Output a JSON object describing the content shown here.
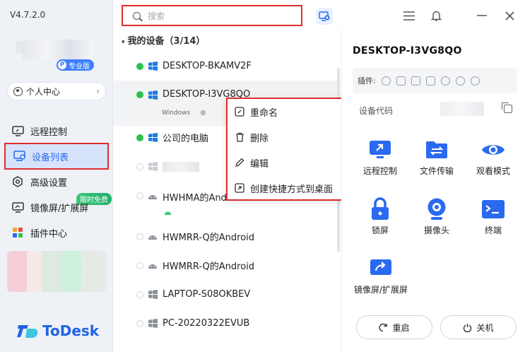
{
  "app": {
    "version": "V4.7.2.0",
    "pro_badge_letter": "P",
    "pro_badge": "专业版",
    "personal_center": "个人中心",
    "logo_text": "ToDesk"
  },
  "sidebar": {
    "items": [
      {
        "label": "远程控制",
        "icon": "monitor-icon"
      },
      {
        "label": "设备列表",
        "icon": "device-list-icon",
        "active": true
      },
      {
        "label": "高级设置",
        "icon": "gear-icon"
      },
      {
        "label": "镜像屏/扩展屏",
        "icon": "mirror-screen-icon"
      },
      {
        "label": "插件中心",
        "icon": "plugin-icon"
      }
    ],
    "free_tag": "限时免费"
  },
  "search": {
    "placeholder": "搜索"
  },
  "list": {
    "group_title": "我的设备（3/14）",
    "devices": [
      {
        "name": "DESKTOP-BKAMV2F",
        "online": true,
        "os": "windows"
      },
      {
        "name": "DESKTOP-I3VG8QO",
        "online": true,
        "os": "windows",
        "selected": true,
        "sub": "Windows"
      },
      {
        "name": "公司的电脑",
        "online": true,
        "os": "windows"
      },
      {
        "name": "",
        "online": false,
        "os": "windows"
      },
      {
        "name": "HWHMA的Android",
        "online": false,
        "os": "android"
      },
      {
        "name": "HWMRR-Q的Android",
        "online": false,
        "os": "android"
      },
      {
        "name": "HWMRR-Q的Android",
        "online": false,
        "os": "android"
      },
      {
        "name": "LAPTOP-S08OKBEV",
        "online": false,
        "os": "windows"
      },
      {
        "name": "PC-20220322EVUB",
        "online": false,
        "os": "windows"
      }
    ]
  },
  "context_menu": {
    "items": [
      {
        "label": "重命名",
        "icon": "rename-icon"
      },
      {
        "label": "删除",
        "icon": "trash-icon"
      },
      {
        "label": "编辑",
        "icon": "pencil-icon"
      },
      {
        "label": "创建快捷方式到桌面",
        "icon": "shortcut-icon"
      }
    ]
  },
  "detail": {
    "title": "DESKTOP-I3VG8QO",
    "plugins_label": "插件:",
    "device_code_label": "设备代码",
    "features": [
      {
        "label": "远程控制",
        "icon": "remote-control-icon"
      },
      {
        "label": "文件传输",
        "icon": "file-transfer-icon"
      },
      {
        "label": "观看模式",
        "icon": "eye-icon"
      },
      {
        "label": "锁屏",
        "icon": "lock-icon"
      },
      {
        "label": "摄像头",
        "icon": "camera-icon"
      },
      {
        "label": "终端",
        "icon": "terminal-icon"
      },
      {
        "label": "镜像屏/扩展屏",
        "icon": "mirror-screen-icon"
      }
    ],
    "restart": "重启",
    "shutdown": "关机"
  },
  "colors": {
    "accent": "#2a6af0",
    "online": "#2bc24b",
    "highlight": "#e02c2c"
  }
}
